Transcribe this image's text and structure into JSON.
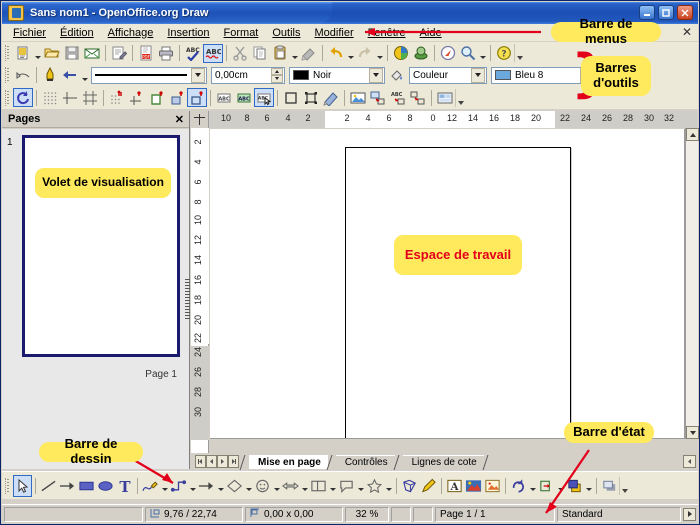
{
  "window": {
    "title": "Sans nom1 - OpenOffice.org Draw",
    "icon": "draw-app-icon",
    "buttons": [
      {
        "name": "minimize",
        "glyph": "_"
      },
      {
        "name": "maximize",
        "glyph": "□"
      },
      {
        "name": "close",
        "glyph": "✕"
      }
    ]
  },
  "menubar": {
    "items": [
      {
        "label": "Fichier",
        "accel": "F"
      },
      {
        "label": "Édition",
        "accel": "d"
      },
      {
        "label": "Affichage",
        "accel": "A"
      },
      {
        "label": "Insertion",
        "accel": "I"
      },
      {
        "label": "Format",
        "accel": "t"
      },
      {
        "label": "Outils",
        "accel": "O"
      },
      {
        "label": "Modifier",
        "accel": "M"
      },
      {
        "label": "Fenêtre",
        "accel": "ê"
      },
      {
        "label": "Aide",
        "accel": "e"
      }
    ],
    "close_doc_glyph": "✕"
  },
  "toolbars": {
    "standard": [
      {
        "name": "new-document",
        "icon": "new-doc-icon",
        "dropdown": true
      },
      {
        "name": "open",
        "icon": "open-folder-icon"
      },
      {
        "name": "save",
        "icon": "save-disk-icon"
      },
      {
        "name": "send-email",
        "icon": "envelope-icon"
      },
      {
        "sep": true
      },
      {
        "name": "edit-file",
        "icon": "edit-file-icon"
      },
      {
        "sep": true
      },
      {
        "name": "export-pdf",
        "icon": "pdf-icon"
      },
      {
        "name": "print",
        "icon": "printer-icon"
      },
      {
        "sep": true
      },
      {
        "name": "spellcheck",
        "icon": "abc-check-icon"
      },
      {
        "name": "autospellcheck",
        "icon": "abc-wave-icon",
        "active": true
      },
      {
        "sep": true
      },
      {
        "name": "cut",
        "icon": "scissors-icon"
      },
      {
        "name": "copy",
        "icon": "copy-icon"
      },
      {
        "name": "paste",
        "icon": "clipboard-icon",
        "dropdown": true
      },
      {
        "name": "clone-formatting",
        "icon": "paintbrush-icon"
      },
      {
        "sep": true
      },
      {
        "name": "undo",
        "icon": "undo-arrow-icon",
        "dropdown": true
      },
      {
        "name": "redo",
        "icon": "redo-arrow-icon",
        "dropdown": true
      },
      {
        "sep": true
      },
      {
        "name": "insert-chart",
        "icon": "pie-chart-icon"
      },
      {
        "name": "insert-3d-object",
        "icon": "3d-scene-icon"
      },
      {
        "sep": true
      },
      {
        "name": "show-draw-functions",
        "icon": "compass-icon"
      },
      {
        "name": "zoom",
        "icon": "magnifier-icon",
        "dropdown": true
      },
      {
        "sep": true
      },
      {
        "name": "help",
        "icon": "help-question-icon"
      }
    ],
    "line_and_fill": {
      "arrow_style_button": "line-endpoint-icon",
      "line_color_button": "pen-icon",
      "arrow_button": "arrow-style-icon",
      "line_style": {
        "label": "",
        "preview": "solid-line"
      },
      "line_width": {
        "value": "0,00cm"
      },
      "line_color": {
        "label": "Noir",
        "swatch": "#000000"
      },
      "area_style_button": "paint-can-icon",
      "fill_type": {
        "label": "Couleur"
      },
      "fill_color": {
        "label": "Bleu 8",
        "swatch": "#6aa8dd"
      },
      "shadow_button": "shadow-icon"
    },
    "options": [
      {
        "name": "rotation-mode",
        "icon": "rotate-icon",
        "active": true
      },
      {
        "sep": true
      },
      {
        "name": "display-grid",
        "icon": "grid-icon"
      },
      {
        "name": "display-snap-guides",
        "icon": "snap-guide-icon"
      },
      {
        "name": "helplines-while-moving",
        "icon": "helplines-icon"
      },
      {
        "sep": true
      },
      {
        "name": "snap-to-grid",
        "icon": "snap-grid-icon"
      },
      {
        "name": "snap-to-snap-lines",
        "icon": "snap-lines-icon"
      },
      {
        "name": "snap-to-page-margins",
        "icon": "snap-margins-icon"
      },
      {
        "name": "snap-to-object-border",
        "icon": "snap-border-icon"
      },
      {
        "name": "snap-to-object-points",
        "icon": "snap-points-icon",
        "active": true
      },
      {
        "sep": true
      },
      {
        "name": "simple-handles",
        "icon": "simple-handles-icon"
      },
      {
        "name": "large-handles",
        "icon": "large-handles-icon"
      },
      {
        "name": "allow-quick-editing",
        "icon": "quick-edit-icon",
        "active": true
      },
      {
        "sep": true
      },
      {
        "name": "select-text-area-only",
        "icon": "text-area-icon"
      },
      {
        "name": "double-click-to-edit",
        "icon": "dbl-click-icon"
      },
      {
        "name": "filter-graphics",
        "icon": "filter-icon"
      },
      {
        "sep": true
      },
      {
        "name": "insert-image",
        "icon": "image-insert-icon"
      },
      {
        "name": "insert-textbox",
        "icon": "textbox-insert-icon"
      },
      {
        "name": "insert-text-frame",
        "icon": "text-frame-icon"
      },
      {
        "name": "insert-object",
        "icon": "object-insert-icon"
      },
      {
        "sep": true
      },
      {
        "name": "gallery",
        "icon": "gallery-icon"
      }
    ]
  },
  "pages_panel": {
    "title": "Pages",
    "close_glyph": "✕",
    "page_number": "1",
    "page_label": "Page 1",
    "thumbnail_callout": "Volet de visualisation"
  },
  "rulers": {
    "horizontal": {
      "negative_ticks": [
        "10",
        "8",
        "6",
        "4",
        "2"
      ],
      "page_ticks": [
        "2",
        "4",
        "6",
        "8",
        "0",
        "12",
        "14",
        "16",
        "18",
        "20"
      ],
      "overflow_ticks": [
        "22",
        "24",
        "26",
        "28",
        "30",
        "32"
      ],
      "origin_icon": "ruler-origin-icon"
    },
    "vertical": {
      "page_ticks": [
        "2",
        "4",
        "6",
        "8",
        "10",
        "12",
        "14",
        "16",
        "18",
        "20",
        "22"
      ],
      "overflow_ticks": [
        "24",
        "26",
        "28",
        "30"
      ]
    }
  },
  "canvas": {
    "callout": "Espace de travail"
  },
  "layer_tabs": {
    "nav_buttons": [
      "⏮",
      "◀",
      "▶",
      "⏭"
    ],
    "items": [
      {
        "label": "Mise en page",
        "active": true
      },
      {
        "label": "Contrôles",
        "active": false
      },
      {
        "label": "Lignes de cote",
        "active": false
      }
    ],
    "scroll_right_glyph": "◀"
  },
  "drawing_toolbar": [
    {
      "name": "select",
      "icon": "cursor-arrow-icon",
      "active": true
    },
    {
      "sep": true
    },
    {
      "name": "line",
      "icon": "line-icon"
    },
    {
      "name": "line-ends-with-arrow",
      "icon": "arrow-line-icon"
    },
    {
      "name": "rectangle",
      "icon": "rectangle-icon"
    },
    {
      "name": "ellipse",
      "icon": "ellipse-icon"
    },
    {
      "name": "text",
      "icon": "text-T-icon"
    },
    {
      "sep": true
    },
    {
      "name": "curve",
      "icon": "curve-pencil-icon",
      "dropdown": true
    },
    {
      "name": "connector",
      "icon": "connector-icon",
      "dropdown": true
    },
    {
      "name": "lines-and-arrows",
      "icon": "arrow-right-icon",
      "dropdown": true
    },
    {
      "name": "basic-shapes",
      "icon": "diamond-shape-icon",
      "dropdown": true
    },
    {
      "name": "symbol-shapes",
      "icon": "smiley-icon",
      "dropdown": true
    },
    {
      "name": "block-arrows",
      "icon": "block-arrow-icon",
      "dropdown": true
    },
    {
      "name": "flowchart",
      "icon": "flowchart-icon",
      "dropdown": true
    },
    {
      "name": "callouts",
      "icon": "callout-bubble-icon",
      "dropdown": true
    },
    {
      "name": "stars",
      "icon": "star-icon",
      "dropdown": true
    },
    {
      "sep": true
    },
    {
      "name": "3d-objects",
      "icon": "3d-object-icon"
    },
    {
      "name": "points",
      "icon": "points-pencil-icon"
    },
    {
      "sep": true
    },
    {
      "name": "fontwork-gallery",
      "icon": "fontwork-icon"
    },
    {
      "name": "from-file",
      "icon": "image-file-icon"
    },
    {
      "name": "gallery",
      "icon": "gallery-frame-icon"
    },
    {
      "sep": true
    },
    {
      "name": "rotate",
      "icon": "rotate-arrow-icon",
      "dropdown": true
    },
    {
      "name": "alignment",
      "icon": "align-icon",
      "dropdown": true
    },
    {
      "name": "arrange",
      "icon": "arrange-icon",
      "dropdown": true
    },
    {
      "sep": true
    },
    {
      "name": "shadow",
      "icon": "shadow-object-icon"
    }
  ],
  "statusbar": {
    "info_field": "",
    "cursor_position": "9,76 / 22,74",
    "cursor_icon": "position-icon",
    "object_size": "0,00 x 0,00",
    "size_icon": "size-icon",
    "zoom": "32 %",
    "modified": "",
    "signature": "",
    "page": "Page 1 / 1",
    "style": "Standard"
  },
  "annotations": [
    {
      "id": "menubar",
      "label": "Barre de menus"
    },
    {
      "id": "toolbars",
      "label": "Barres\nd'outils",
      "line1": "Barres",
      "line2": "d'outils"
    },
    {
      "id": "viewpane",
      "label": "Volet de visualisation"
    },
    {
      "id": "workspace",
      "label": "Espace de travail"
    },
    {
      "id": "drawbar",
      "label": "Barre de dessin"
    },
    {
      "id": "statusbar",
      "label": "Barre d'état"
    }
  ],
  "colors": {
    "callout_bg": "#ffe95c",
    "annotation_line": "#e2001a",
    "title_bar": "#1b4fb4",
    "workspace_text": "#e2001a",
    "thumb_border": "#1a1a6e"
  }
}
